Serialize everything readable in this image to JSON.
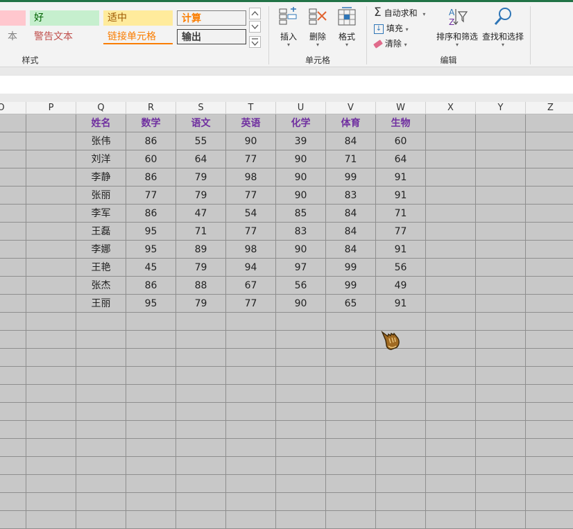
{
  "ribbon": {
    "styles": {
      "row1": [
        "",
        "好",
        "适中",
        "计算"
      ],
      "row2": [
        "本",
        "警告文本",
        "链接单元格",
        "输出"
      ],
      "group_label": "样式"
    },
    "cells": {
      "insert": "插入",
      "delete": "删除",
      "format": "格式",
      "group_label": "单元格"
    },
    "editing": {
      "autosum": "自动求和",
      "fill": "填充",
      "clear": "清除",
      "sort_filter": "排序和筛选",
      "find_select": "查找和选择",
      "group_label": "编辑"
    }
  },
  "columns": [
    "O",
    "P",
    "Q",
    "R",
    "S",
    "T",
    "U",
    "V",
    "W",
    "X",
    "Y",
    "Z"
  ],
  "table": {
    "headers": [
      "姓名",
      "数学",
      "语文",
      "英语",
      "化学",
      "体育",
      "生物"
    ],
    "rows": [
      [
        "张伟",
        "86",
        "55",
        "90",
        "39",
        "84",
        "60"
      ],
      [
        "刘洋",
        "60",
        "64",
        "77",
        "90",
        "71",
        "64"
      ],
      [
        "李静",
        "86",
        "79",
        "98",
        "90",
        "99",
        "91"
      ],
      [
        "张丽",
        "77",
        "79",
        "77",
        "90",
        "83",
        "91"
      ],
      [
        "李军",
        "86",
        "47",
        "54",
        "85",
        "84",
        "71"
      ],
      [
        "王磊",
        "95",
        "71",
        "77",
        "83",
        "84",
        "77"
      ],
      [
        "李娜",
        "95",
        "89",
        "98",
        "90",
        "84",
        "91"
      ],
      [
        "王艳",
        "45",
        "79",
        "94",
        "97",
        "99",
        "56"
      ],
      [
        "张杰",
        "86",
        "88",
        "67",
        "56",
        "99",
        "49"
      ],
      [
        "王丽",
        "95",
        "79",
        "77",
        "90",
        "65",
        "91"
      ]
    ]
  },
  "colors": {
    "header_text": "#7030a0",
    "sheet_fill": "#c8c8c8",
    "good_fill": "#c6efce",
    "neutral_fill": "#ffeb9c",
    "bad_fill": "#ffc7ce",
    "calc_text": "#fa7d00",
    "warn_text": "#c0504d"
  }
}
